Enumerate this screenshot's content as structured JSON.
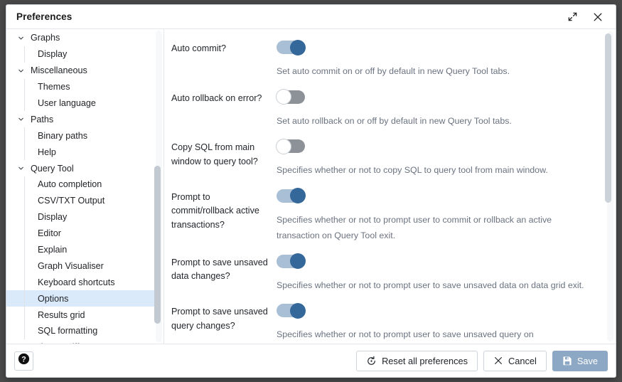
{
  "window": {
    "title": "Preferences",
    "expand_icon": "expand-icon",
    "close_icon": "close-icon"
  },
  "sidebar": {
    "items": [
      {
        "label": "Graphs",
        "type": "group",
        "expanded": true,
        "selected": false
      },
      {
        "label": "Display",
        "type": "child",
        "expanded": false,
        "selected": false
      },
      {
        "label": "Miscellaneous",
        "type": "group",
        "expanded": true,
        "selected": false
      },
      {
        "label": "Themes",
        "type": "child",
        "expanded": false,
        "selected": false
      },
      {
        "label": "User language",
        "type": "child",
        "expanded": false,
        "selected": false
      },
      {
        "label": "Paths",
        "type": "group",
        "expanded": true,
        "selected": false
      },
      {
        "label": "Binary paths",
        "type": "child",
        "expanded": false,
        "selected": false
      },
      {
        "label": "Help",
        "type": "child",
        "expanded": false,
        "selected": false
      },
      {
        "label": "Query Tool",
        "type": "group",
        "expanded": true,
        "selected": false
      },
      {
        "label": "Auto completion",
        "type": "child",
        "expanded": false,
        "selected": false
      },
      {
        "label": "CSV/TXT Output",
        "type": "child",
        "expanded": false,
        "selected": false
      },
      {
        "label": "Display",
        "type": "child",
        "expanded": false,
        "selected": false
      },
      {
        "label": "Editor",
        "type": "child",
        "expanded": false,
        "selected": false
      },
      {
        "label": "Explain",
        "type": "child",
        "expanded": false,
        "selected": false
      },
      {
        "label": "Graph Visualiser",
        "type": "child",
        "expanded": false,
        "selected": false
      },
      {
        "label": "Keyboard shortcuts",
        "type": "child",
        "expanded": false,
        "selected": false
      },
      {
        "label": "Options",
        "type": "child",
        "expanded": false,
        "selected": true
      },
      {
        "label": "Results grid",
        "type": "child",
        "expanded": false,
        "selected": false
      },
      {
        "label": "SQL formatting",
        "type": "child",
        "expanded": false,
        "selected": false
      },
      {
        "label": "Schema Diff",
        "type": "group",
        "expanded": true,
        "selected": false
      }
    ]
  },
  "main": {
    "preferences": [
      {
        "label": "Auto commit?",
        "state": "on",
        "help": "Set auto commit on or off by default in new Query Tool tabs."
      },
      {
        "label": "Auto rollback on error?",
        "state": "off",
        "help": "Set auto rollback on or off by default in new Query Tool tabs."
      },
      {
        "label": "Copy SQL from main window to query tool?",
        "state": "off",
        "help": "Specifies whether or not to copy SQL to query tool from main window."
      },
      {
        "label": "Prompt to commit/rollback active transactions?",
        "state": "on",
        "help": "Specifies whether or not to prompt user to commit or rollback an active transaction on Query Tool exit."
      },
      {
        "label": "Prompt to save unsaved data changes?",
        "state": "on",
        "help": "Specifies whether or not to prompt user to save unsaved data on data grid exit."
      },
      {
        "label": "Prompt to save unsaved query changes?",
        "state": "on",
        "help": "Specifies whether or not to prompt user to save unsaved query on"
      }
    ]
  },
  "footer": {
    "help_icon": "question-mark-icon",
    "reset_label": "Reset all preferences",
    "reset_icon": "reset-icon",
    "cancel_label": "Cancel",
    "cancel_icon": "close-icon",
    "save_label": "Save",
    "save_icon": "save-disk-icon"
  },
  "colors": {
    "selected_item_bg": "#dbeafb",
    "selected_item_marker": "#1c5d9e",
    "toggle_on_knob": "#34679a",
    "toggle_on_track": "#a9bfd6",
    "toggle_off_track": "#8d9298",
    "save_button_bg": "#8da8c4",
    "help_text": "#6a7380"
  }
}
